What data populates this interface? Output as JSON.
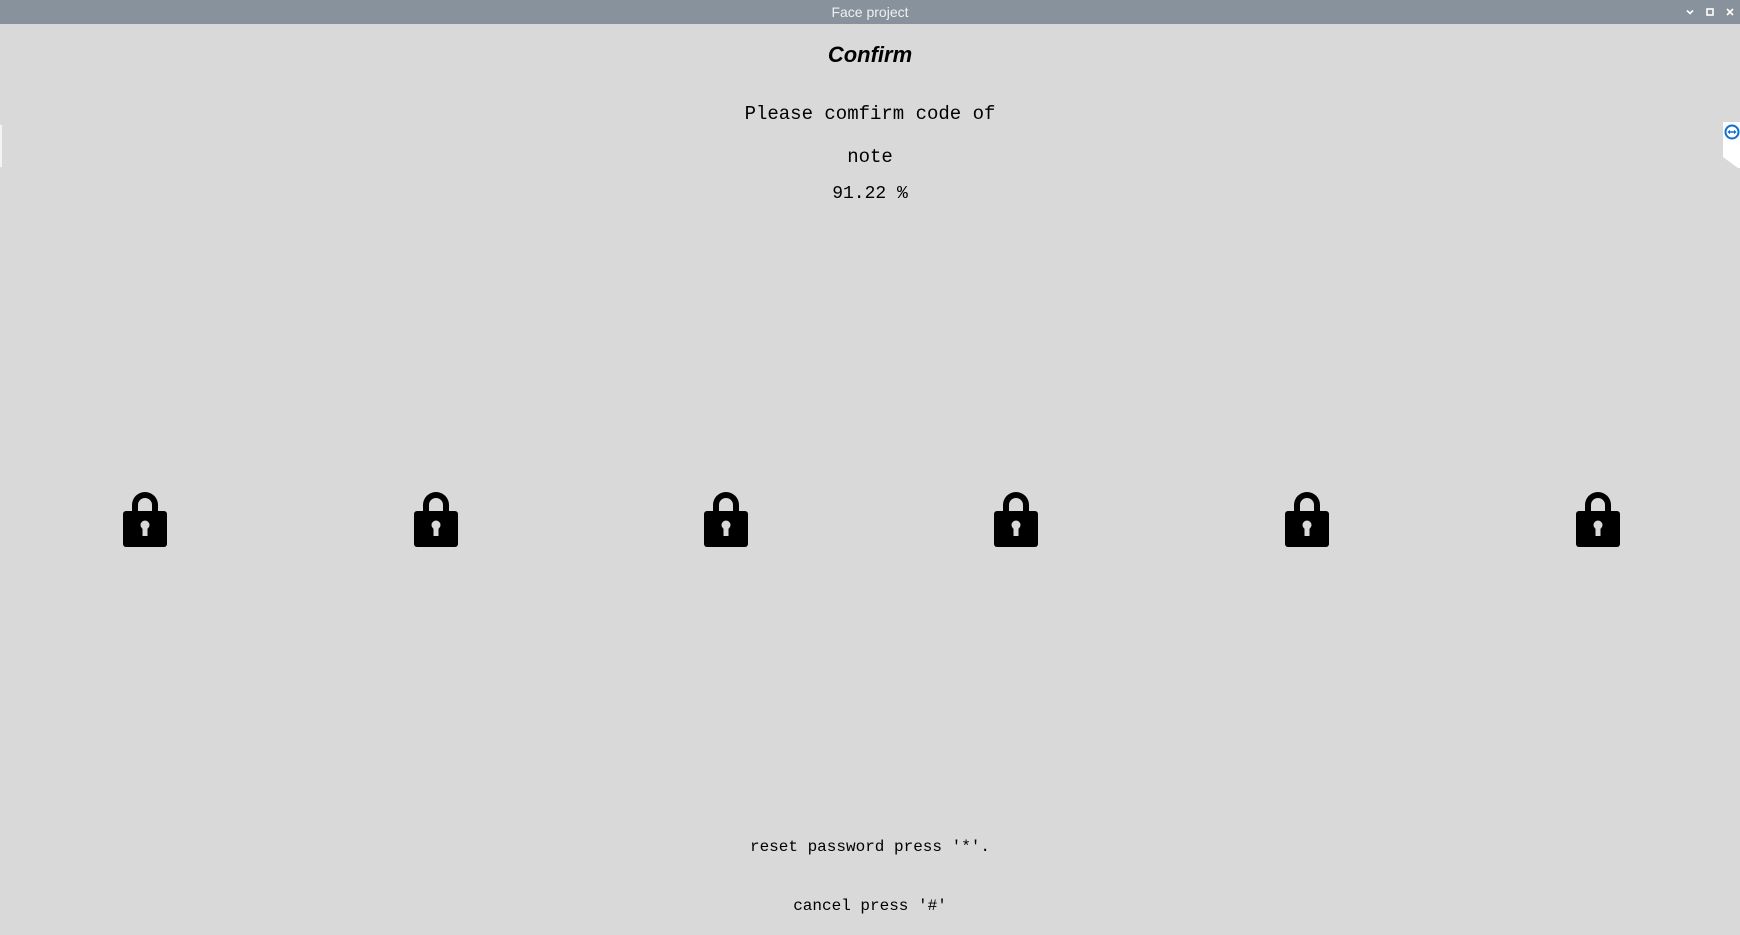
{
  "window": {
    "title": "Face project",
    "controls": [
      "minimize-icon",
      "maximize-icon",
      "close-icon"
    ]
  },
  "content": {
    "heading": "Confirm",
    "prompt_line1": "Please comfirm code of",
    "prompt_line2": "note",
    "confidence": "91.22 %",
    "locks": [
      "lock-icon",
      "lock-icon",
      "lock-icon",
      "lock-icon",
      "lock-icon",
      "lock-icon"
    ],
    "reset_hint": "reset password press '*'.",
    "cancel_hint": "cancel press '#'"
  },
  "side_tab": {
    "icon": "remote-control-icon",
    "accent": "#0e6fd1"
  },
  "colors": {
    "background": "#d9d9d9",
    "titlebar": "#87929c",
    "text": "#000000"
  }
}
